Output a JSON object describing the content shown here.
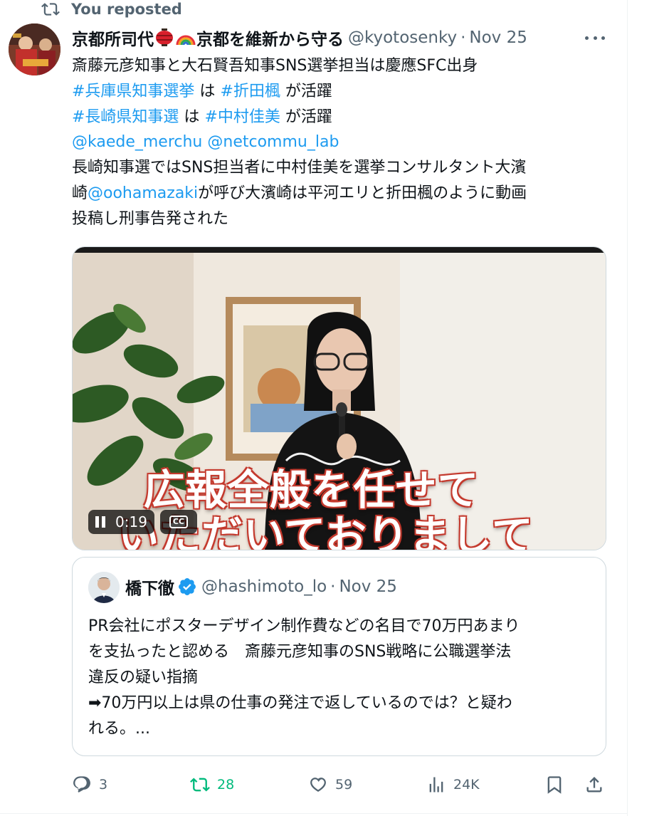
{
  "repost_banner": {
    "label": "You reposted",
    "icon": "repost-icon"
  },
  "tweet": {
    "author_name": "京都所司代",
    "author_name_suffix": "京都を維新から守る",
    "handle": "@kyotosenky",
    "separator": "·",
    "date": "Nov 25",
    "emojis": [
      "red-lantern-emoji",
      "rainbow-emoji"
    ],
    "body": {
      "line1": "斎藤元彦知事と大石賢吾知事SNS選挙担当は慶應SFC出身",
      "line2_tag1": "#兵庫県知事選挙",
      "line2_mid": " は ",
      "line2_tag2": "#折田楓",
      "line2_end": " が活躍",
      "line3_tag1": "#長崎県知事選",
      "line3_mid": " は ",
      "line3_tag2": "#中村佳美",
      "line3_end": " が活躍",
      "line4_mention1": "@kaede_merchu",
      "line4_space": " ",
      "line4_mention2": "@netcommu_lab",
      "line5": "長崎知事選ではSNS担当者に中村佳美を選挙コンサルタント大濱",
      "line6_start": "崎",
      "line6_mention": "@oohamazaki",
      "line6_end": "が呼び大濱崎は平河エリと折田楓のように動画",
      "line7": "投稿し刑事告発された"
    },
    "video": {
      "caption_line1": "広報全般を任せて",
      "caption_line2": "いただいておりまして",
      "time": "0:19",
      "cc_label": "CC"
    }
  },
  "quoted_tweet": {
    "author_name": "橋下徹",
    "handle": "@hashimoto_lo",
    "separator": "·",
    "date": "Nov 25",
    "body": {
      "line1": "PR会社にポスターデザイン制作費などの名目で70万円あまり",
      "line2": "を支払ったと認める　斎藤元彦知事のSNS戦略に公職選挙法",
      "line3": "違反の疑い指摘",
      "line4": "➡70万円以上は県の仕事の発注で返しているのでは？と疑わ",
      "line5": "れる。..."
    }
  },
  "actions": {
    "replies": "3",
    "reposts": "28",
    "likes": "59",
    "views": "24K"
  },
  "colors": {
    "link": "#1d9bf0",
    "repost_active": "#00ba7c",
    "muted": "#536471",
    "verified": "#1d9bf0"
  }
}
